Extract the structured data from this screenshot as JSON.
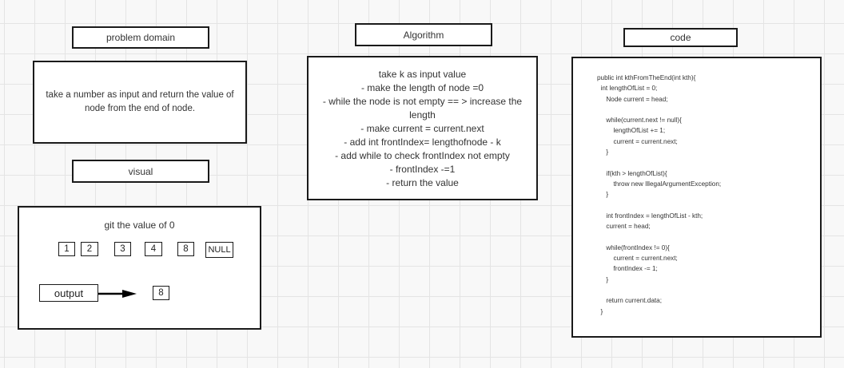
{
  "problem_domain": {
    "label": "problem domain",
    "text": "take a number as input and return the value of node from the end of node."
  },
  "algorithm": {
    "label": "Algorithm",
    "lines": [
      "take k as input value",
      "- make the length of node =0",
      "- while the node is not empty == > increase the length",
      "- make current = current.next",
      "- add int frontIndex= lengthofnode - k",
      "- add while to check frontIndex not empty",
      "- frontIndex -=1",
      "- return the value"
    ]
  },
  "code": {
    "label": "code",
    "lines": [
      "public int kthFromTheEnd(int kth){",
      "  int lengthOfList = 0;",
      "     Node current = head;",
      "",
      "     while(current.next != null){",
      "         lengthOfList += 1;",
      "         current = current.next;",
      "     }",
      "",
      "     if(kth > lengthOfList){",
      "         throw new IllegalArgumentException;",
      "     }",
      "",
      "     int frontIndex = lengthOfList - kth;",
      "     current = head;",
      "",
      "     while(frontIndex != 0){",
      "         current = current.next;",
      "         frontIndex -= 1;",
      "     }",
      "",
      "     return current.data;",
      "  }"
    ]
  },
  "visual": {
    "label": "visual",
    "caption": "git the value of 0",
    "nodes": [
      "1",
      "2",
      "3",
      "4",
      "8",
      "NULL"
    ],
    "output_label": "output",
    "output_value": "8"
  }
}
